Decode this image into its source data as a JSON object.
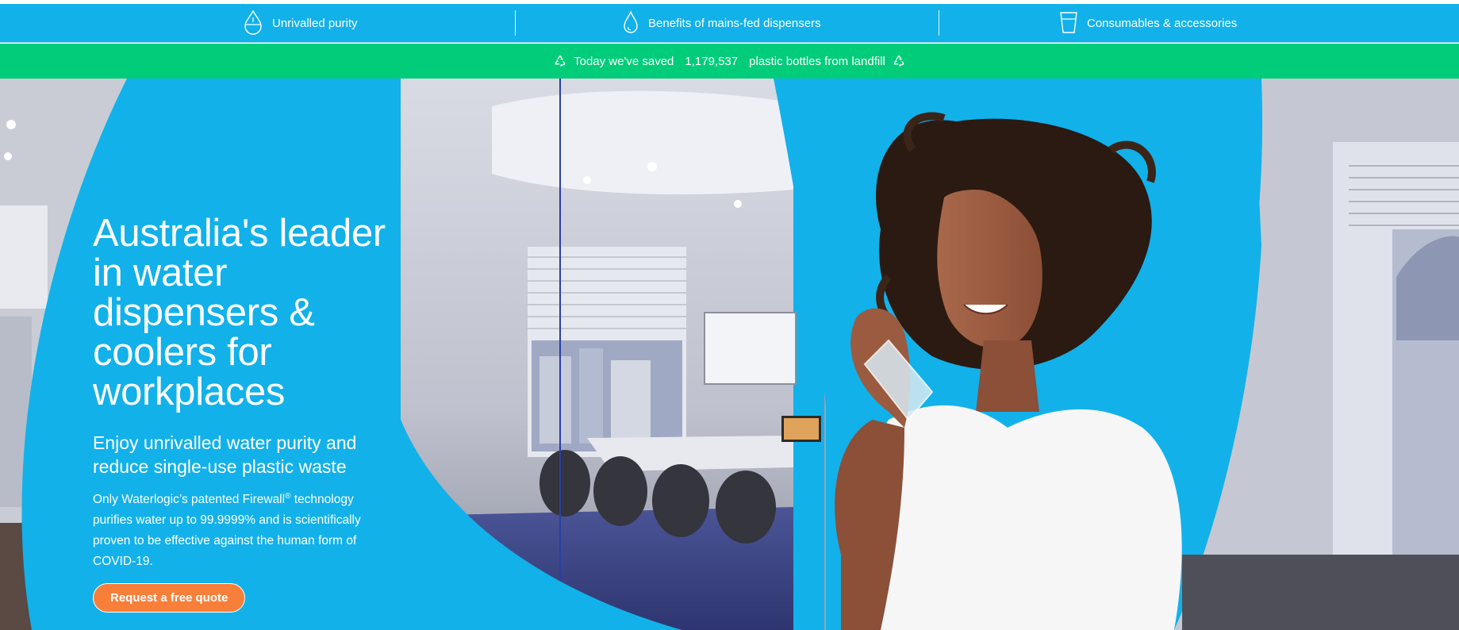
{
  "features": [
    {
      "label": "Unrivalled purity",
      "icon": "water-drop-icon"
    },
    {
      "label": "Benefits of mains-fed dispensers",
      "icon": "droplet-icon"
    },
    {
      "label": "Consumables & accessories",
      "icon": "cup-icon"
    }
  ],
  "savings": {
    "prefix": "Today we've saved",
    "count": "1,179,537",
    "suffix": "plastic bottles from landfill",
    "icon": "recycle-icon"
  },
  "hero": {
    "title": "Australia's leader in water dispensers & coolers for workplaces",
    "subtitle": "Enjoy unrivalled water purity and reduce single-use plastic waste",
    "body_before": "Only Waterlogic’s patented Firewall",
    "body_sup": "®",
    "body_after": " technology purifies water up to 99.9999% and is scientifically proven to be effective against the human form of COVID-19.",
    "cta_label": "Request a free quote"
  },
  "colors": {
    "brand_blue": "#12b1ea",
    "savings_green": "#00cc7a",
    "cta_orange": "#f87f3a"
  }
}
